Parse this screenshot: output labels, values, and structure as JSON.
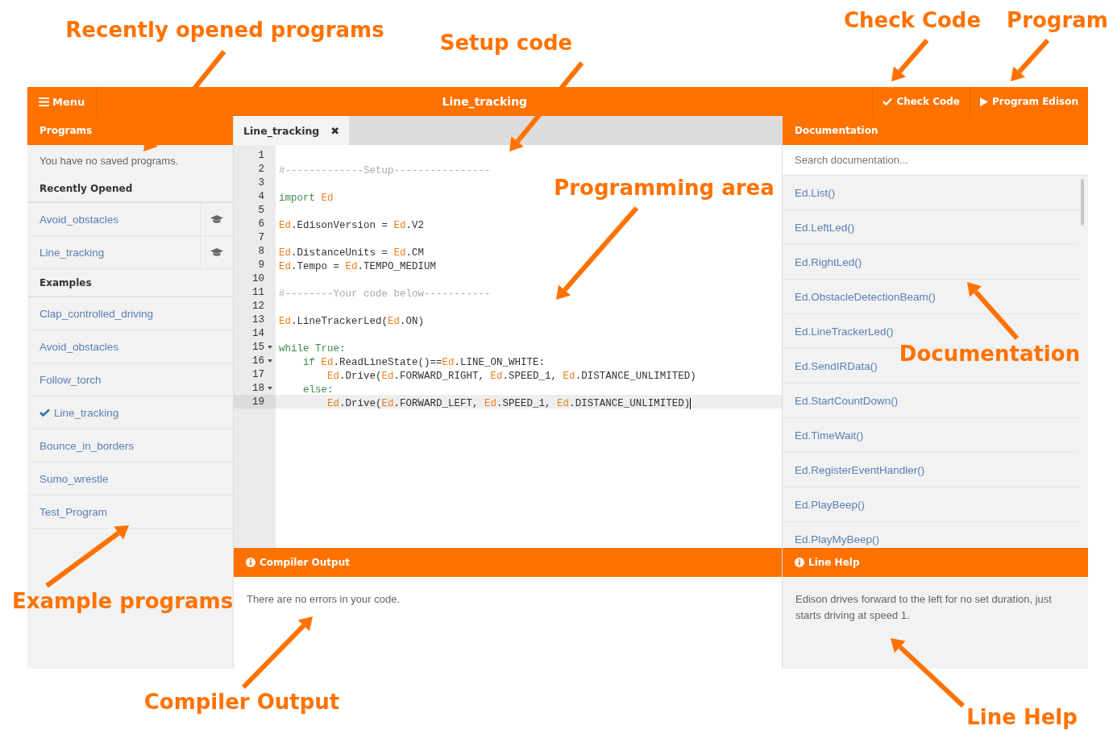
{
  "top_bar": {
    "menu": "Menu",
    "title": "Line_tracking",
    "check_button": "Check Code",
    "program_button": "Program Edison"
  },
  "programs": {
    "header": "Programs",
    "notice": "You have no saved programs.",
    "recent_heading": "Recently Opened",
    "recent": [
      {
        "label": "Avoid_obstacles"
      },
      {
        "label": "Line_tracking"
      }
    ],
    "examples_heading": "Examples",
    "examples": [
      {
        "label": "Clap_controlled_driving",
        "selected": false
      },
      {
        "label": "Avoid_obstacles",
        "selected": false
      },
      {
        "label": "Follow_torch",
        "selected": false
      },
      {
        "label": "Line_tracking",
        "selected": true
      },
      {
        "label": "Bounce_in_borders",
        "selected": false
      },
      {
        "label": "Sumo_wrestle",
        "selected": false
      },
      {
        "label": "Test_Program",
        "selected": false
      }
    ]
  },
  "editor": {
    "tabs": [
      {
        "label": "Line_tracking",
        "close": "✖",
        "selected": true
      }
    ],
    "lines": [
      {
        "number": "1",
        "foldable": false,
        "current": false
      },
      {
        "number": "2",
        "foldable": false,
        "current": false,
        "tokens": [
          {
            "kind": "comment",
            "text": "#-------------Setup----------------"
          }
        ]
      },
      {
        "number": "3",
        "foldable": false,
        "current": false
      },
      {
        "number": "4",
        "foldable": false,
        "current": false,
        "tokens": [
          {
            "kind": "keyword",
            "text": "import"
          },
          {
            "kind": "ed",
            "text": " Ed"
          }
        ]
      },
      {
        "number": "5",
        "foldable": false,
        "current": false
      },
      {
        "number": "6",
        "foldable": false,
        "current": false,
        "tokens": [
          {
            "kind": "ed",
            "text": "Ed"
          },
          {
            "kind": "plain",
            "text": ".EdisonVersion = "
          },
          {
            "kind": "ed",
            "text": "Ed"
          },
          {
            "kind": "plain",
            "text": ".V2"
          }
        ]
      },
      {
        "number": "7",
        "foldable": false,
        "current": false
      },
      {
        "number": "8",
        "foldable": false,
        "current": false,
        "tokens": [
          {
            "kind": "ed",
            "text": "Ed"
          },
          {
            "kind": "plain",
            "text": ".DistanceUnits = "
          },
          {
            "kind": "ed",
            "text": "Ed"
          },
          {
            "kind": "plain",
            "text": ".CM"
          }
        ]
      },
      {
        "number": "9",
        "foldable": false,
        "current": false,
        "tokens": [
          {
            "kind": "ed",
            "text": "Ed"
          },
          {
            "kind": "plain",
            "text": ".Tempo = "
          },
          {
            "kind": "ed",
            "text": "Ed"
          },
          {
            "kind": "plain",
            "text": ".TEMPO_MEDIUM"
          }
        ]
      },
      {
        "number": "10",
        "foldable": false,
        "current": false
      },
      {
        "number": "11",
        "foldable": false,
        "current": false,
        "tokens": [
          {
            "kind": "comment",
            "text": "#--------Your code below-----------"
          }
        ]
      },
      {
        "number": "12",
        "foldable": false,
        "current": false
      },
      {
        "number": "13",
        "foldable": false,
        "current": false,
        "tokens": [
          {
            "kind": "ed",
            "text": "Ed"
          },
          {
            "kind": "plain",
            "text": ".LineTrackerLed("
          },
          {
            "kind": "ed",
            "text": "Ed"
          },
          {
            "kind": "plain",
            "text": ".ON)"
          }
        ]
      },
      {
        "number": "14",
        "foldable": false,
        "current": false
      },
      {
        "number": "15",
        "foldable": true,
        "current": false,
        "tokens": [
          {
            "kind": "keyword",
            "text": "while True:"
          }
        ]
      },
      {
        "number": "16",
        "foldable": true,
        "current": false,
        "tokens": [
          {
            "kind": "keyword",
            "text": "    if"
          },
          {
            "kind": "ed",
            "text": " Ed"
          },
          {
            "kind": "plain",
            "text": ".ReadLineState()=="
          },
          {
            "kind": "ed",
            "text": "Ed"
          },
          {
            "kind": "plain",
            "text": ".LINE_ON_WHITE:"
          }
        ]
      },
      {
        "number": "17",
        "foldable": false,
        "current": false,
        "tokens": [
          {
            "kind": "ed",
            "text": "        Ed"
          },
          {
            "kind": "plain",
            "text": ".Drive("
          },
          {
            "kind": "ed",
            "text": "Ed"
          },
          {
            "kind": "plain",
            "text": ".FORWARD_RIGHT, "
          },
          {
            "kind": "ed",
            "text": "Ed"
          },
          {
            "kind": "plain",
            "text": ".SPEED_1, "
          },
          {
            "kind": "ed",
            "text": "Ed"
          },
          {
            "kind": "plain",
            "text": ".DISTANCE_UNLIMITED)"
          }
        ]
      },
      {
        "number": "18",
        "foldable": true,
        "current": false,
        "tokens": [
          {
            "kind": "keyword",
            "text": "    else:"
          }
        ]
      },
      {
        "number": "19",
        "foldable": false,
        "current": true,
        "tokens": [
          {
            "kind": "ed",
            "text": "        Ed"
          },
          {
            "kind": "plain",
            "text": ".Drive("
          },
          {
            "kind": "ed",
            "text": "Ed"
          },
          {
            "kind": "plain",
            "text": ".FORWARD_LEFT, "
          },
          {
            "kind": "ed",
            "text": "Ed"
          },
          {
            "kind": "plain",
            "text": ".SPEED_1, "
          },
          {
            "kind": "ed",
            "text": "Ed"
          },
          {
            "kind": "plain",
            "text": ".DISTANCE_UNLIMITED)"
          }
        ]
      }
    ]
  },
  "compiler_output": {
    "header": "Compiler Output",
    "message": "There are no errors in your code."
  },
  "documentation": {
    "header": "Documentation",
    "search": {
      "placeholder": "Search documentation..."
    },
    "items": [
      "Ed.List()",
      "Ed.LeftLed()",
      "Ed.RightLed()",
      "Ed.ObstacleDetectionBeam()",
      "Ed.LineTrackerLed()",
      "Ed.SendIRData()",
      "Ed.StartCountDown()",
      "Ed.TimeWait()",
      "Ed.RegisterEventHandler()",
      "Ed.PlayBeep()",
      "Ed.PlayMyBeep()"
    ]
  },
  "line_help": {
    "header": "Line Help",
    "text": "Edison drives forward to the left for no set duration, just starts driving at speed 1."
  },
  "annotations": [
    {
      "label": "Recently opened programs"
    },
    {
      "label": "Setup code"
    },
    {
      "label": "Check Code"
    },
    {
      "label": "Program"
    },
    {
      "label": "Programming area"
    },
    {
      "label": "Documentation"
    },
    {
      "label": "Example programs"
    },
    {
      "label": "Compiler Output"
    },
    {
      "label": "Line Help"
    }
  ]
}
